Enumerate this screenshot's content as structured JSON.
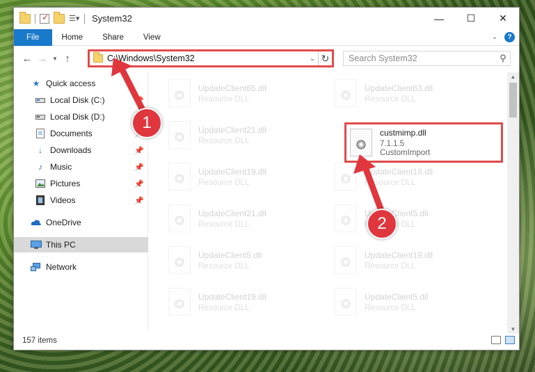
{
  "window": {
    "title": "System32",
    "controls": [
      "—",
      "☐",
      "✕"
    ]
  },
  "ribbon": {
    "tabs": [
      "File",
      "Home",
      "Share",
      "View"
    ]
  },
  "address": {
    "path": "C:\\Windows\\System32",
    "search_placeholder": "Search System32"
  },
  "nav_pane": {
    "items": [
      {
        "label": "Quick access",
        "icon": "star-icon"
      },
      {
        "label": "Local Disk (C:)",
        "icon": "drive-icon",
        "pinned": true
      },
      {
        "label": "Local Disk (D:)",
        "icon": "drive-icon",
        "pinned": true
      },
      {
        "label": "Documents",
        "icon": "documents-icon",
        "pinned": true
      },
      {
        "label": "Downloads",
        "icon": "download-icon",
        "pinned": true
      },
      {
        "label": "Music",
        "icon": "music-icon",
        "pinned": true
      },
      {
        "label": "Pictures",
        "icon": "pictures-icon",
        "pinned": true
      },
      {
        "label": "Videos",
        "icon": "videos-icon",
        "pinned": true
      },
      {
        "label": "OneDrive",
        "icon": "cloud-icon"
      },
      {
        "label": "This PC",
        "icon": "computer-icon",
        "selected": true
      },
      {
        "label": "Network",
        "icon": "network-icon"
      }
    ]
  },
  "files": {
    "left_column": [
      {
        "name": "UpdateClient65.dll",
        "desc": "Resource DLL"
      },
      {
        "name": "UpdateClient21.dll",
        "desc": "Resource DLL"
      },
      {
        "name": "UpdateClient19.dll",
        "desc": "Resource DLL"
      },
      {
        "name": "UpdateClient21.dll",
        "desc": "Resource DLL"
      },
      {
        "name": "UpdateClient5.dll",
        "desc": "Resource DLL"
      },
      {
        "name": "UpdateClient19.dll",
        "desc": "Resource DLL"
      }
    ],
    "right_column": [
      {
        "name": "UpdateClient63.dll",
        "desc": "Resource DLL"
      },
      {
        "name": "UpdateClient19.dll",
        "desc": "Resource DLL"
      },
      {
        "name": "UpdateClient5.dll",
        "desc": "Resource DLL"
      },
      {
        "name": "UpdateClient19.dll",
        "desc": "Resource DLL"
      },
      {
        "name": "UpdateClient5.dll",
        "desc": "Resource DLL"
      }
    ],
    "highlighted": {
      "name": "custmimp.dll",
      "version": "7.1.1.5",
      "desc": "CustomImport"
    }
  },
  "status": {
    "item_count": "157 items"
  },
  "annotations": {
    "step1": "1",
    "step2": "2",
    "color": "#e0373f"
  }
}
